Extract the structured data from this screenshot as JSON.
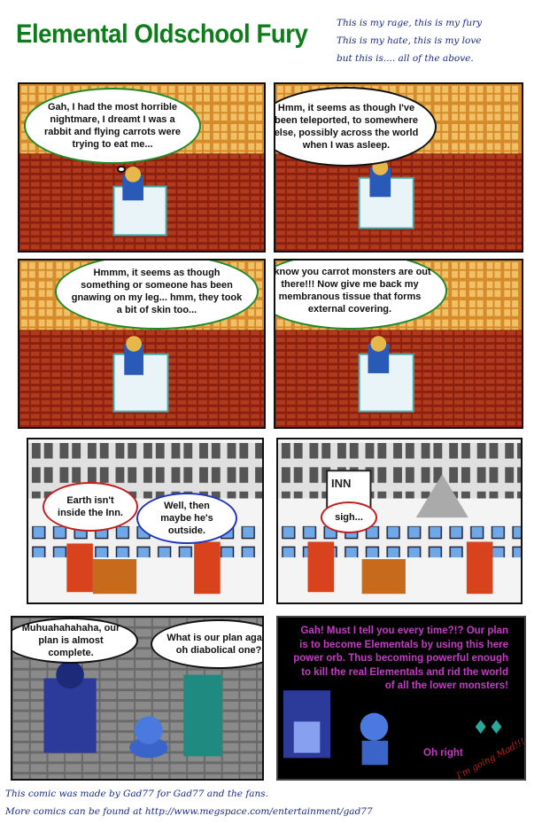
{
  "header": {
    "title": "Elemental Oldschool Fury",
    "poem": [
      "This is  my rage, this is my fury",
      "This is my hate, this is my love",
      "but this is.... all of the above."
    ]
  },
  "panels": {
    "p1": "Gah, I had the most horrible nightmare, I dreamt I was a rabbit and flying carrots were trying to eat me...",
    "p2": "Hmm, it seems as though I've been teleported, to somewhere else, possibly across the world when I was asleep.",
    "p3": "Hmmm, it seems as though something or someone has been gnawing on my leg...  hmm, they took a bit of skin too...",
    "p4": "I know you carrot monsters are out there!!!  Now give me back my membranous tissue that forms external covering.",
    "p5a": "Earth isn't inside the Inn.",
    "p5b": "Well, then maybe he's outside.",
    "p6": "sigh...",
    "p6_sign": "INN",
    "p7a": "Muhuahahahaha, our plan is almost complete.",
    "p7b": "What is our plan again oh diabolical one?",
    "p8": "Gah!  Must I tell you every time?!? Our plan is to become Elementals by using this here power orb. Thus becoming powerful enough to kill the real Elementals and rid the world of all the lower monsters!",
    "p8b": "Oh right"
  },
  "footer": {
    "line1": "This comic was made by Gad77 for Gad77 and the fans.",
    "line2": "More comics can be found at http://www.megspace.com/entertainment/gad77",
    "aside": "I'm going Mad!!!"
  },
  "colors": {
    "title": "#0e7c1a",
    "poem": "#1a2a8a",
    "villain_text": "#c33cc4",
    "aside": "#c0201c"
  }
}
